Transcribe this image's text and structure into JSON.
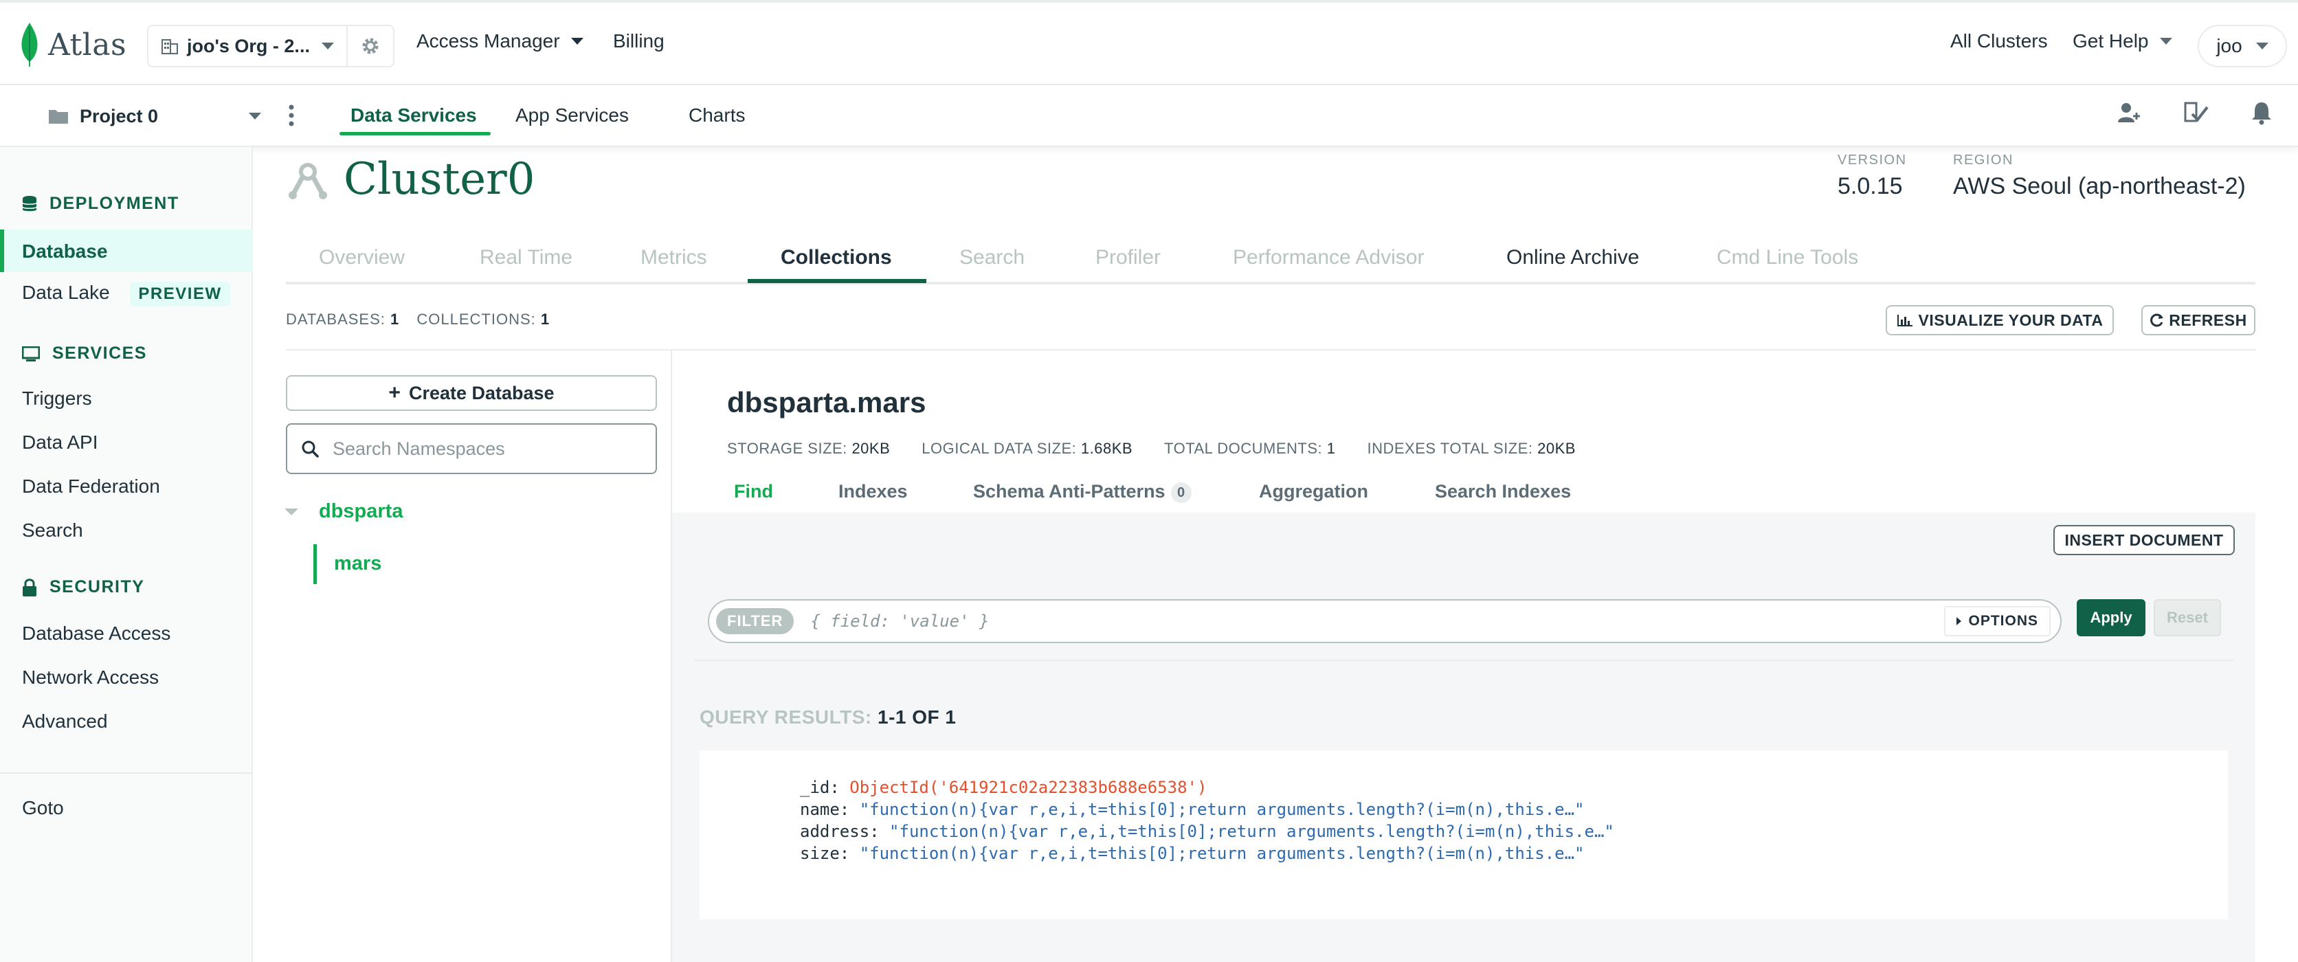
{
  "top": {
    "brand": "Atlas",
    "org": "joo's Org - 2...",
    "nav": [
      "Access Manager",
      "Billing"
    ],
    "right": [
      "All Clusters",
      "Get Help"
    ],
    "user": "joo"
  },
  "project": {
    "name": "Project 0",
    "tabs": [
      "Data Services",
      "App Services",
      "Charts"
    ]
  },
  "sidebar": {
    "deployment": "DEPLOYMENT",
    "database": "Database",
    "data_lake": "Data Lake",
    "preview": "PREVIEW",
    "services": "SERVICES",
    "service_items": [
      "Triggers",
      "Data API",
      "Data Federation",
      "Search"
    ],
    "security": "SECURITY",
    "security_items": [
      "Database Access",
      "Network Access",
      "Advanced"
    ],
    "goto": "Goto"
  },
  "cluster": {
    "name": "Cluster0",
    "version_label": "VERSION",
    "version": "5.0.15",
    "region_label": "REGION",
    "region": "AWS Seoul (ap-northeast-2)",
    "tabs": [
      "Overview",
      "Real Time",
      "Metrics",
      "Collections",
      "Search",
      "Profiler",
      "Performance Advisor",
      "Online Archive",
      "Cmd Line Tools"
    ]
  },
  "collections": {
    "databases_label": "DATABASES:",
    "databases": "1",
    "collections_label": "COLLECTIONS:",
    "collections": "1",
    "visualize": "VISUALIZE YOUR DATA",
    "refresh": "REFRESH",
    "create_db": "Create Database",
    "search_placeholder": "Search Namespaces",
    "db_name": "dbsparta",
    "coll_name": "mars"
  },
  "namespace": {
    "title": "dbsparta.mars",
    "storage_label": "STORAGE SIZE:",
    "storage": "20KB",
    "logical_label": "LOGICAL DATA SIZE:",
    "logical": "1.68KB",
    "docs_label": "TOTAL DOCUMENTS:",
    "docs": "1",
    "indexes_label": "INDEXES TOTAL SIZE:",
    "indexes": "20KB",
    "tabs": [
      "Find",
      "Indexes",
      "Schema Anti-Patterns",
      "Aggregation",
      "Search Indexes"
    ],
    "anti_patterns_count": "0"
  },
  "find": {
    "insert": "INSERT DOCUMENT",
    "filter": "FILTER",
    "filter_placeholder": "{ field: 'value' }",
    "options": "OPTIONS",
    "apply": "Apply",
    "reset": "Reset",
    "results_label": "QUERY RESULTS:",
    "results_range": "1-1 OF 1"
  },
  "document": {
    "id_key": "_id:",
    "id_value": "ObjectId('641921c02a22383b688e6538')",
    "name_key": "name:",
    "name_value": "\"function(n){var r,e,i,t=this[0];return arguments.length?(i=m(n),this.e…\"",
    "address_key": "address:",
    "address_value": "\"function(n){var r,e,i,t=this[0];return arguments.length?(i=m(n),this.e…\"",
    "size_key": "size:",
    "size_value": "\"function(n){var r,e,i,t=this[0];return arguments.length?(i=m(n),this.e…\""
  },
  "colors": {
    "accent": "#13aa52",
    "dark_green": "#116149",
    "oid": "#e3502b",
    "string": "#2e6ab0"
  }
}
